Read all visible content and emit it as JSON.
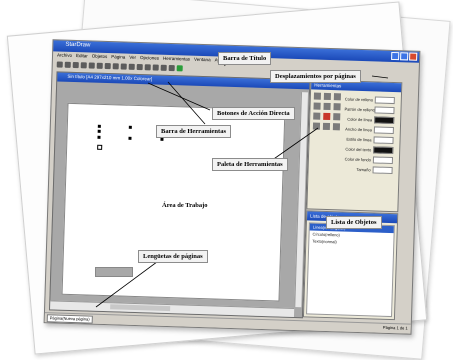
{
  "app": {
    "title": "StarDraw",
    "doc_title": "Sin título [A4 297x210 mm 1.00x Colorear]",
    "menu": [
      "Archivo",
      "Editar",
      "Objetos",
      "Página",
      "Ver",
      "Opciones",
      "Herramientas",
      "Ventana",
      "Ayuda"
    ]
  },
  "panels": {
    "tools_title": "Herramientas",
    "props": [
      "Color de relleno",
      "Patrón de relleno",
      "Color de línea",
      "Ancho de línea",
      "Estilo de línea",
      "Color del texto",
      "Color de fondo",
      "Tamaño"
    ],
    "objects_title": "Lista de objetos",
    "objects": [
      "Línea(rectangular)",
      "Círculo(relleno)",
      "Texto(normal)"
    ]
  },
  "status": {
    "tabs": "Página(Nueva página)",
    "page": "Página 1 de 1"
  },
  "callouts": {
    "title_bar": "Barra de Título",
    "page_scroll": "Desplazamientos por páginas",
    "direct_buttons": "Botones de Acción Directa",
    "toolbar": "Barra de Herramientas",
    "tool_palette": "Paleta de Herramientas",
    "work_area": "Área de Trabajo",
    "object_list": "Lista de Objetos",
    "page_tabs": "Lengüetas de páginas"
  }
}
